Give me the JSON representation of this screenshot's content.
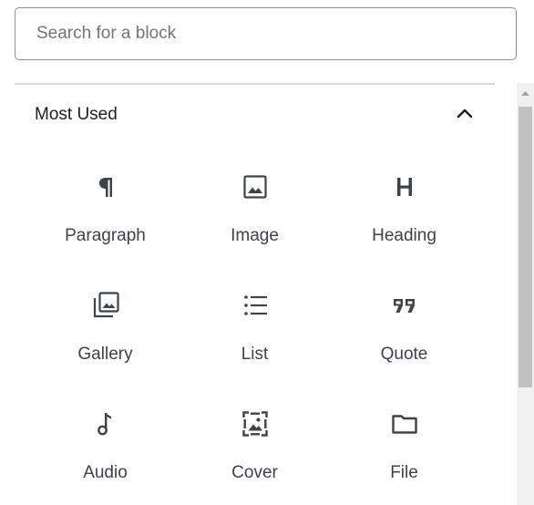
{
  "search": {
    "placeholder": "Search for a block",
    "value": ""
  },
  "panel": {
    "title": "Most Used",
    "expanded": true
  },
  "blocks": [
    {
      "label": "Paragraph",
      "icon": "paragraph-icon"
    },
    {
      "label": "Image",
      "icon": "image-icon"
    },
    {
      "label": "Heading",
      "icon": "heading-icon"
    },
    {
      "label": "Gallery",
      "icon": "gallery-icon"
    },
    {
      "label": "List",
      "icon": "list-icon"
    },
    {
      "label": "Quote",
      "icon": "quote-icon"
    },
    {
      "label": "Audio",
      "icon": "audio-icon"
    },
    {
      "label": "Cover",
      "icon": "cover-icon"
    },
    {
      "label": "File",
      "icon": "folder-icon"
    }
  ],
  "colors": {
    "icon": "#3c434a",
    "border": "#8c8f94",
    "divider": "#dcdcde",
    "scroll_track": "#f1f1f1",
    "scroll_thumb": "#c1c1c1"
  }
}
